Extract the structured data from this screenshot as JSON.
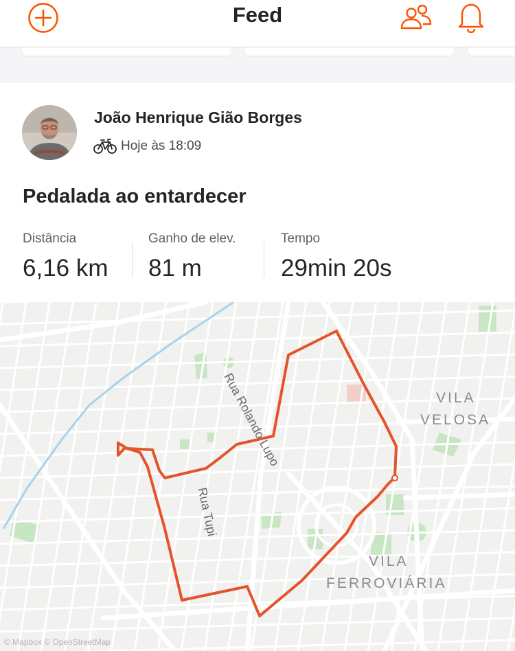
{
  "header": {
    "title": "Feed",
    "icons": [
      "add-circle-icon",
      "people-icon",
      "bell-icon"
    ],
    "accent_color": "#fc5200"
  },
  "activity": {
    "athlete_name": "João Henrique Gião Borges",
    "timestamp": "Hoje às 18:09",
    "sport_icon": "bike-icon",
    "title": "Pedalada ao entardecer",
    "stats": [
      {
        "label": "Distância",
        "value": "6,16 km"
      },
      {
        "label": "Ganho de elev.",
        "value": "81 m"
      },
      {
        "label": "Tempo",
        "value": "29min 20s"
      }
    ]
  },
  "map": {
    "route_color": "#fc5200",
    "neighborhood_labels": [
      "VILA",
      "VELOSA",
      "VILA",
      "FERROVIÁRIA"
    ],
    "street_labels": [
      "Rua Rolando Lupo",
      "Rua Tupi"
    ],
    "attribution": "© Mapbox © OpenStreetMap"
  }
}
